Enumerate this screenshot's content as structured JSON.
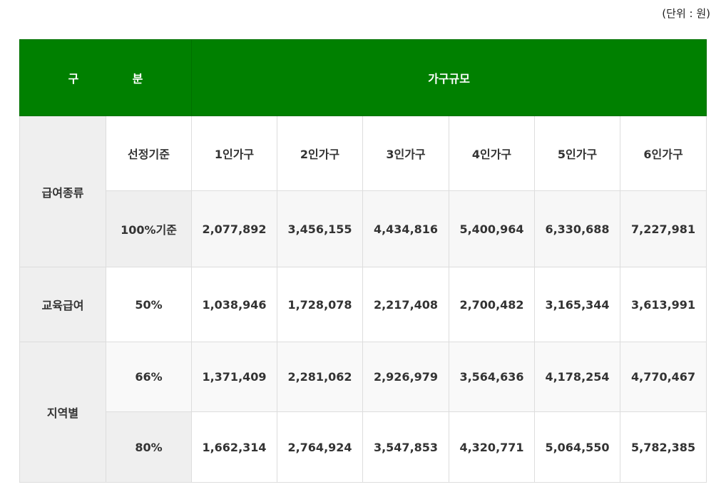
{
  "unit_note": "(단위 : 원)",
  "header": {
    "division_left": "구",
    "division_right": "분",
    "household_size": "가구규모"
  },
  "groups": {
    "benefit_type": "급여종류",
    "education": "교육급여",
    "regional": "지역별"
  },
  "columns": [
    "1인가구",
    "2인가구",
    "3인가구",
    "4인가구",
    "5인가구",
    "6인가구"
  ],
  "rows": [
    {
      "label": "선정기준",
      "values": []
    },
    {
      "label": "100%기준",
      "values": [
        "2,077,892",
        "3,456,155",
        "4,434,816",
        "5,400,964",
        "6,330,688",
        "7,227,981"
      ]
    },
    {
      "label": "50%",
      "values": [
        "1,038,946",
        "1,728,078",
        "2,217,408",
        "2,700,482",
        "3,165,344",
        "3,613,991"
      ]
    },
    {
      "label": "66%",
      "values": [
        "1,371,409",
        "2,281,062",
        "2,926,979",
        "3,564,636",
        "4,178,254",
        "4,770,467"
      ]
    },
    {
      "label": "80%",
      "values": [
        "1,662,314",
        "2,764,924",
        "3,547,853",
        "4,320,771",
        "5,064,550",
        "5,782,385"
      ]
    }
  ]
}
